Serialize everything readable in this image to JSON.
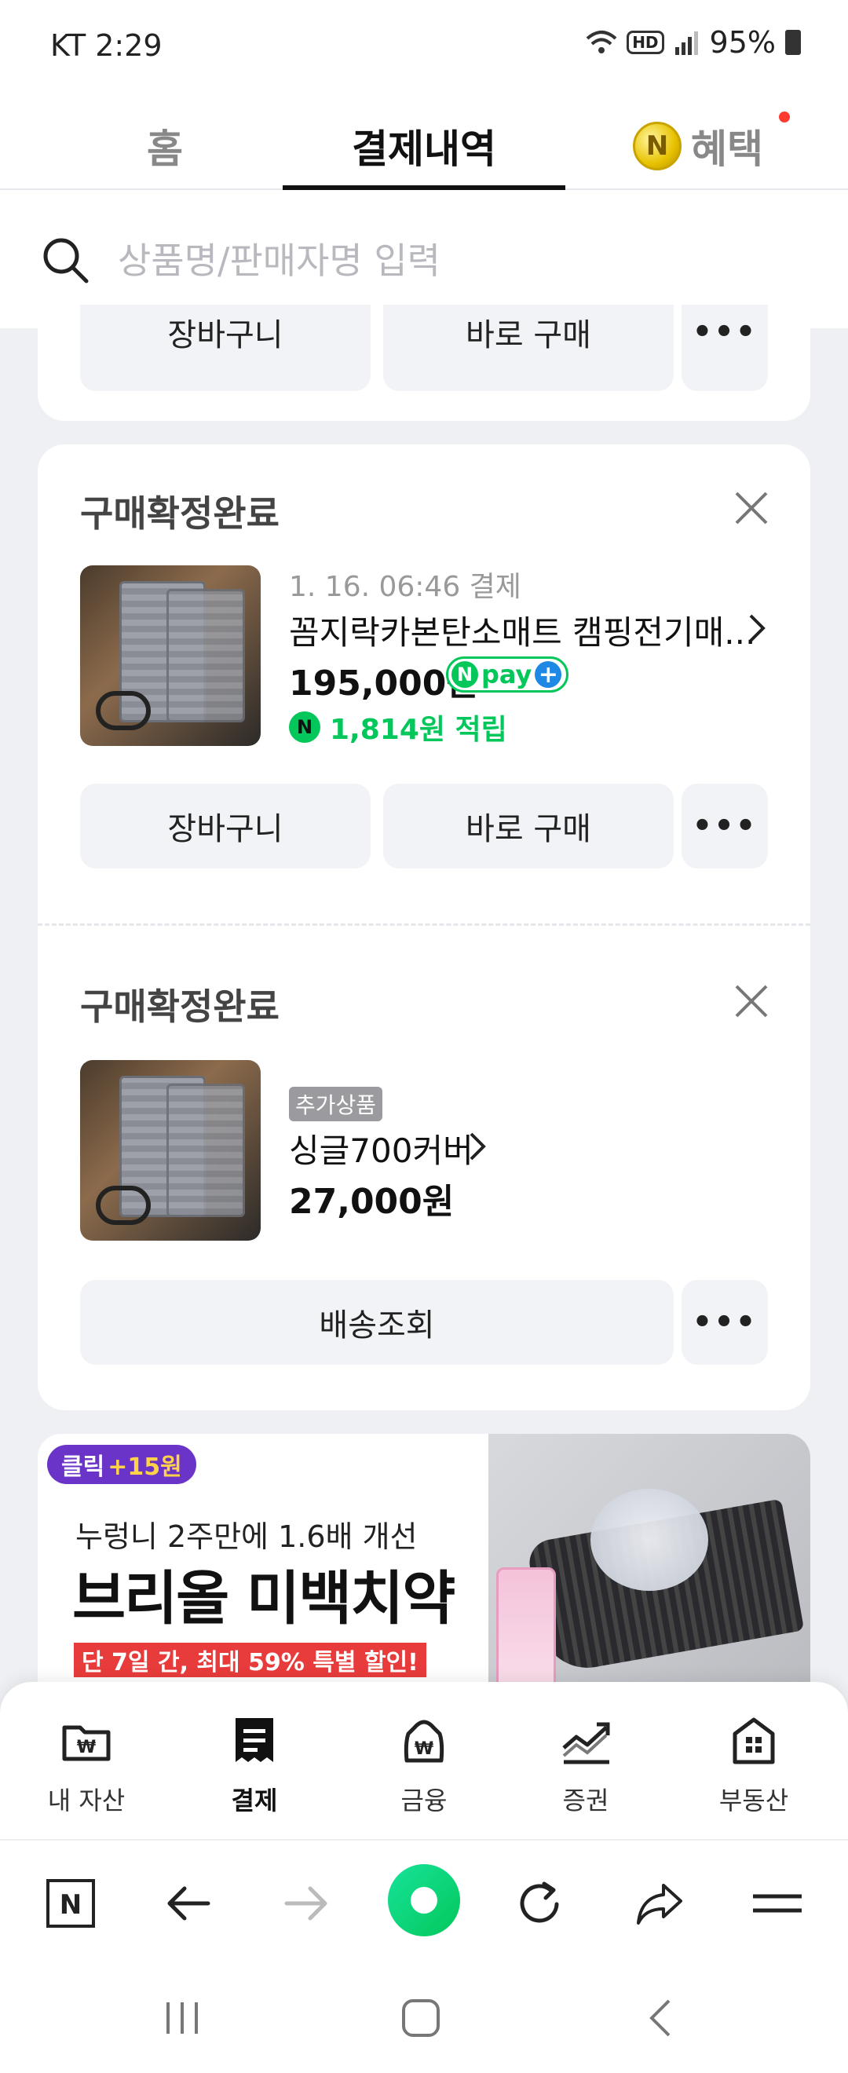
{
  "status_bar": {
    "time": "KT 2:29",
    "hd": "HD",
    "battery": "95%"
  },
  "tabs": {
    "home": "홈",
    "payments": "결제내역",
    "benefits": "혜택",
    "coin_glyph": "N"
  },
  "search": {
    "placeholder": "상품명/판매자명 입력"
  },
  "top_card": {
    "cart_label": "장바구니",
    "buy_label": "바로 구매",
    "more_label": "•••"
  },
  "orders": [
    {
      "status": "구매확정완료",
      "date": "1. 16. 06:46 결제",
      "product_name": "꼼지락카본탄소매트 캠핑전기매...",
      "price": "195,000원",
      "npay": "pay",
      "reward": "1,814원 적립",
      "cart_label": "장바구니",
      "buy_label": "바로 구매",
      "more_label": "•••"
    },
    {
      "status": "구매확정완료",
      "tag": "추가상품",
      "product_name": "싱글700커버",
      "price": "27,000원",
      "track_label": "배송조회",
      "more_label": "•••"
    }
  ],
  "ad": {
    "badge_text": "클릭",
    "badge_highlight": "+15원",
    "line1": "누렁니 2주만에 1.6배 개선",
    "line2": "브리올 미백치약",
    "line3": "단 7일 간, 최대 59% 특별 할인!"
  },
  "service_nav": [
    {
      "label": "내 자산",
      "icon": "wallet-folder-icon"
    },
    {
      "label": "결제",
      "icon": "receipt-icon"
    },
    {
      "label": "금융",
      "icon": "money-bag-icon"
    },
    {
      "label": "증권",
      "icon": "stock-chart-icon"
    },
    {
      "label": "부동산",
      "icon": "building-icon"
    }
  ],
  "browser_bar": {
    "home_glyph": "N",
    "icons": [
      "naver-home-icon",
      "back-arrow-icon",
      "forward-arrow-icon",
      "green-dot-icon",
      "refresh-icon",
      "share-icon",
      "menu-icon"
    ]
  },
  "colors": {
    "naver_green": "#03c75a",
    "ad_purple": "#6a34c9",
    "ad_red": "#e83b3b",
    "background": "#eef0f4"
  }
}
